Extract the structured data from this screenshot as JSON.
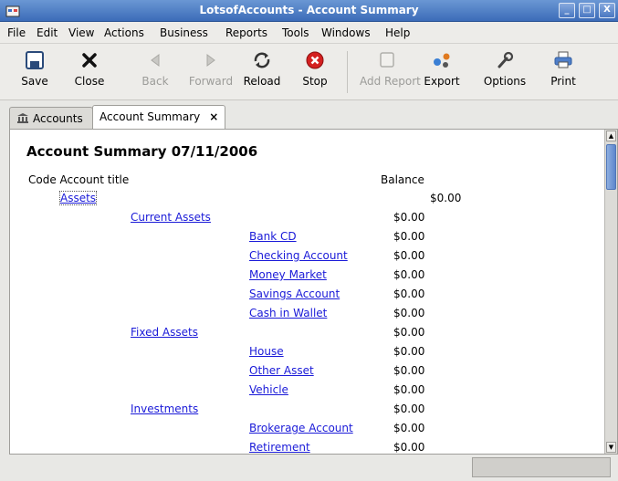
{
  "window": {
    "title": "LotsofAccounts - Account Summary",
    "controls": [
      "_",
      "□",
      "X"
    ]
  },
  "menu": [
    "File",
    "Edit",
    "View",
    "Actions",
    "Business",
    "Reports",
    "Tools",
    "Windows",
    "Help"
  ],
  "toolbar": {
    "save": "Save",
    "close": "Close",
    "back": "Back",
    "forward": "Forward",
    "reload": "Reload",
    "stop": "Stop",
    "add_report": "Add Report",
    "export": "Export",
    "options": "Options",
    "print": "Print"
  },
  "tabs": {
    "accounts": "Accounts",
    "summary": "Account Summary",
    "close_glyph": "×"
  },
  "report": {
    "title": "Account Summary 07/11/2006",
    "col_code_title": "Code Account title",
    "col_balance": "Balance",
    "rows": [
      {
        "name": "Assets",
        "balance": "$0.00"
      },
      {
        "name": "Current Assets",
        "balance": "$0.00"
      },
      {
        "name": "Bank CD",
        "balance": "$0.00"
      },
      {
        "name": "Checking Account",
        "balance": "$0.00"
      },
      {
        "name": "Money Market",
        "balance": "$0.00"
      },
      {
        "name": "Savings Account",
        "balance": "$0.00"
      },
      {
        "name": "Cash in Wallet",
        "balance": "$0.00"
      },
      {
        "name": "Fixed Assets",
        "balance": "$0.00"
      },
      {
        "name": "House",
        "balance": "$0.00"
      },
      {
        "name": "Other Asset",
        "balance": "$0.00"
      },
      {
        "name": "Vehicle",
        "balance": "$0.00"
      },
      {
        "name": "Investments",
        "balance": "$0.00"
      },
      {
        "name": "Brokerage Account",
        "balance": "$0.00"
      },
      {
        "name": "Retirement",
        "balance": "$0.00"
      }
    ]
  },
  "icons": {
    "app": "app-icon",
    "save": "floppy-icon",
    "close": "x-icon",
    "back": "arrow-left-icon",
    "forward": "arrow-right-icon",
    "reload": "reload-icon",
    "stop": "stop-icon",
    "add_report": "report-icon",
    "export": "export-icon",
    "options": "wrench-icon",
    "print": "printer-icon",
    "accounts_tab": "bank-icon"
  },
  "colors": {
    "titlebar": "#4a78c2",
    "link": "#1a1ad8",
    "stop": "#d42020"
  }
}
